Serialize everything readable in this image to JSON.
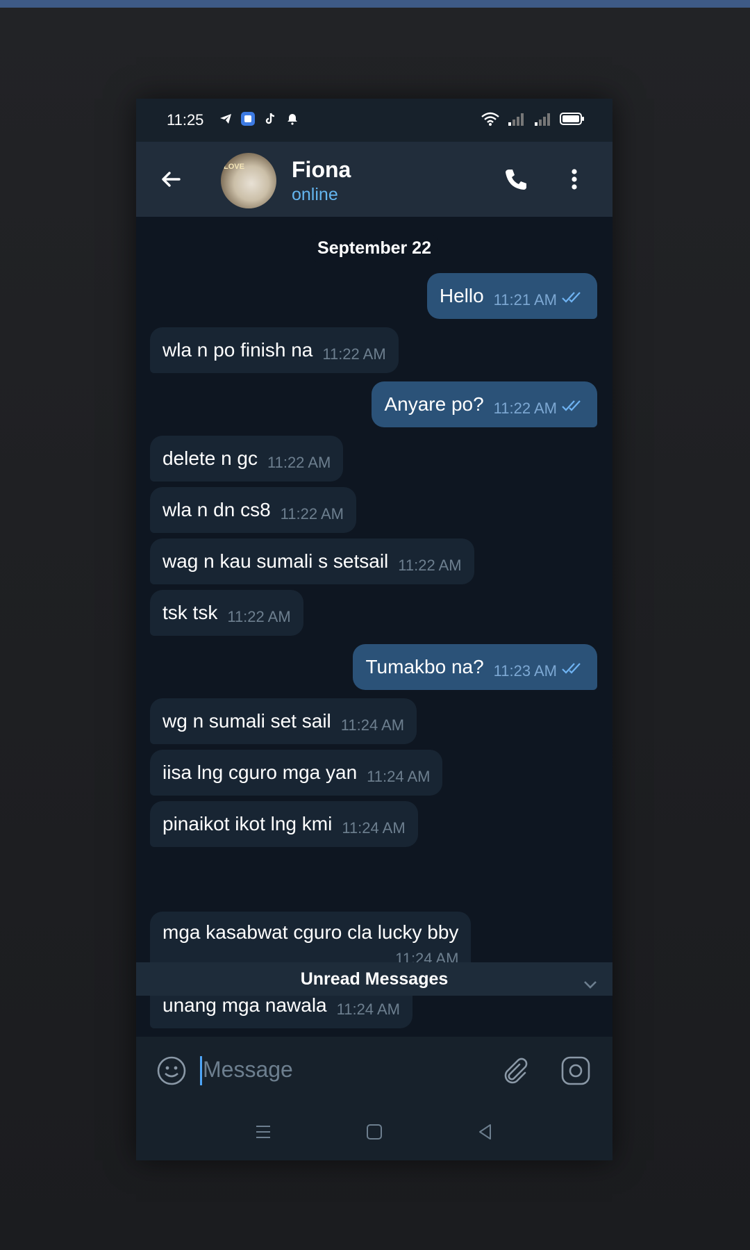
{
  "status": {
    "time": "11:25",
    "left_icons": [
      "telegram-icon",
      "app-icon",
      "tiktok-icon",
      "notification-icon"
    ],
    "right_icons": [
      "wifi-icon",
      "signal-icon",
      "signal-icon",
      "battery-icon"
    ]
  },
  "header": {
    "name": "Fiona",
    "status": "online",
    "avatar_text": "LOVE",
    "icons": [
      "back-arrow-icon",
      "phone-icon",
      "more-vertical-icon"
    ]
  },
  "chat": {
    "date": "September 22",
    "messages": [
      {
        "dir": "out",
        "text": "Hello",
        "time": "11:21 AM"
      },
      {
        "dir": "in",
        "text": "wla n po finish na",
        "time": "11:22 AM"
      },
      {
        "dir": "out",
        "text": "Anyare po?",
        "time": "11:22 AM"
      },
      {
        "dir": "in",
        "text": "delete n gc",
        "time": "11:22 AM"
      },
      {
        "dir": "in",
        "text": "wla n dn cs8",
        "time": "11:22 AM"
      },
      {
        "dir": "in",
        "text": "wag n kau sumali s setsail",
        "time": "11:22 AM"
      },
      {
        "dir": "in",
        "text": "tsk tsk",
        "time": "11:22 AM"
      },
      {
        "dir": "out",
        "text": "Tumakbo na?",
        "time": "11:23 AM"
      },
      {
        "dir": "in",
        "text": "wg n sumali set sail",
        "time": "11:24 AM"
      },
      {
        "dir": "in",
        "text": "iisa lng cguro mga yan",
        "time": "11:24 AM"
      },
      {
        "dir": "in",
        "text": "pinaikot ikot lng kmi",
        "time": "11:24 AM"
      },
      {
        "dir": "in",
        "text": "mga kasabwat cguro cla lucky bby",
        "time": "11:24 AM"
      },
      {
        "dir": "in",
        "text": "unang mga nawala",
        "time": "11:24 AM"
      }
    ],
    "unread_label": "Unread Messages"
  },
  "composer": {
    "placeholder": "Message",
    "icons": [
      "emoji-icon",
      "attach-icon",
      "camera-icon"
    ]
  },
  "navbar": {
    "icons": [
      "menu-icon",
      "home-icon",
      "back-icon"
    ]
  },
  "colors": {
    "header_bg": "#212d3b",
    "chat_bg": "#0e1621",
    "incoming_bubble": "#182533",
    "outgoing_bubble": "#2b5278",
    "accent": "#64b5ef",
    "top_bar": "#3e5a86"
  }
}
